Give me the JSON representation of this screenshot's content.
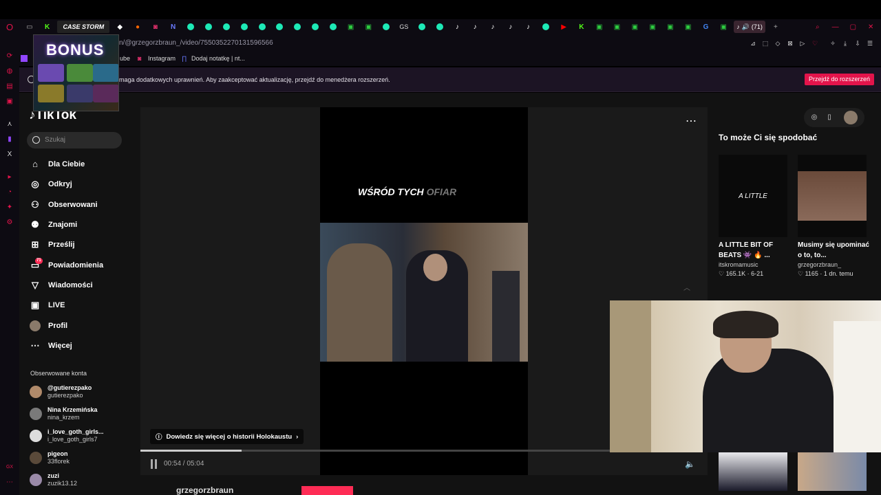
{
  "browser": {
    "url": "n/@grzegorzbraun_/video/7550352270131596566",
    "active_tab_count": "(71)",
    "bookmarks": [
      "ube",
      "Instagram",
      "Dodaj notatkę | nt..."
    ],
    "notification_text": "maga dodatkowych uprawnień. Aby zaakceptować aktualizację, przejdź do menedżera rozszerzeń.",
    "notification_button": "Przejdź do rozszerzeń",
    "tab_logo_text": "CASE STORM"
  },
  "overlay": {
    "bonus_text": "BONUS"
  },
  "tiktok": {
    "logo": "TikTok",
    "search_placeholder": "Szukaj",
    "nav": [
      {
        "label": "Dla Ciebie",
        "icon": "home-icon"
      },
      {
        "label": "Odkryj",
        "icon": "compass-icon"
      },
      {
        "label": "Obserwowani",
        "icon": "following-icon"
      },
      {
        "label": "Znajomi",
        "icon": "friends-icon"
      },
      {
        "label": "Prześlij",
        "icon": "upload-icon"
      },
      {
        "label": "Powiadomienia",
        "icon": "inbox-icon",
        "badge": "71"
      },
      {
        "label": "Wiadomości",
        "icon": "messages-icon"
      },
      {
        "label": "LIVE",
        "icon": "live-icon"
      },
      {
        "label": "Profil",
        "icon": "profile-avatar"
      },
      {
        "label": "Więcej",
        "icon": "more-icon"
      }
    ],
    "followed_title": "Obserwowane konta",
    "followed": [
      {
        "name": "@gutierezpako",
        "handle": "gutierezpako"
      },
      {
        "name": "Nina Krzemińska",
        "handle": "nina_krzem"
      },
      {
        "name": "i_love_goth_girls...",
        "handle": "i_love_goth_girls7"
      },
      {
        "name": "pigeon",
        "handle": "33florek"
      },
      {
        "name": "zuzi",
        "handle": "zuzik13.12"
      }
    ]
  },
  "video": {
    "caption_main": "WŚRÓD TYCH ",
    "caption_fade": "OFIAR",
    "learn_more": "Dowiedz się więcej o historii Holokaustu",
    "time": "00:54 / 05:04",
    "progress": 0.178,
    "author": "grzegorzbraun"
  },
  "suggestions": {
    "title": "To może Ci się spodobać",
    "items": [
      {
        "thumb_text": "A LITTLE",
        "title": "A LITTLE BIT OF BEATS 👾 🔥 ...",
        "user": "itskromamusic",
        "stats": "♡ 165.1K · 6-21"
      },
      {
        "thumb_text": "",
        "title": "Musimy się upominać o to, to...",
        "user": "grzegorzbraun_",
        "stats": "♡ 1165 · 1 dn. temu"
      }
    ]
  },
  "colors": {
    "accent": "#fe2c55",
    "bg": "#121212",
    "opera_red": "#e3144b"
  }
}
